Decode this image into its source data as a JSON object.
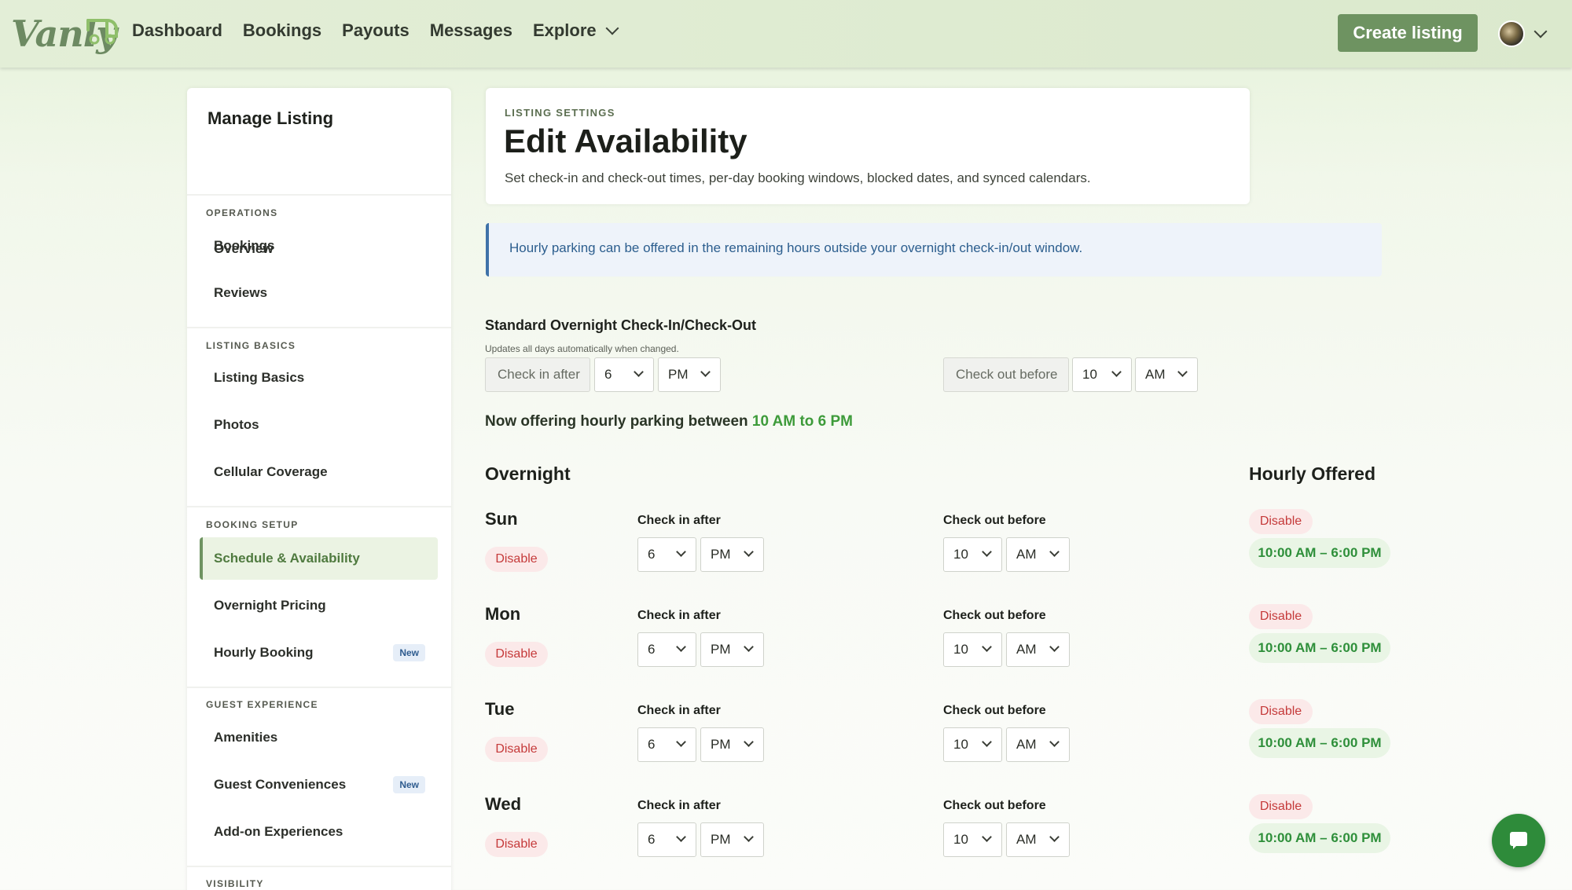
{
  "app": {
    "logo_text": "Vanly"
  },
  "nav": {
    "items": [
      "Dashboard",
      "Bookings",
      "Payouts",
      "Messages",
      "Explore"
    ],
    "create_label": "Create listing"
  },
  "sidebar": {
    "title": "Manage Listing",
    "overview": "Overview",
    "sections": [
      {
        "label": "OPERATIONS",
        "items": [
          "Bookings",
          "Reviews"
        ]
      },
      {
        "label": "LISTING BASICS",
        "items": [
          "Listing Basics",
          "Photos",
          "Cellular Coverage"
        ]
      },
      {
        "label": "BOOKING SETUP",
        "items": [
          "Schedule & Availability",
          "Overnight Pricing",
          "Hourly Booking"
        ]
      },
      {
        "label": "GUEST EXPERIENCE",
        "items": [
          "Amenities",
          "Guest Conveniences",
          "Add-on Experiences"
        ]
      },
      {
        "label": "VISIBILITY",
        "items": []
      }
    ],
    "active_item": "Schedule & Availability",
    "new_badge": "New"
  },
  "header": {
    "eyebrow": "LISTING SETTINGS",
    "title": "Edit Availability",
    "subtitle": "Set check-in and check-out times, per-day booking windows, blocked dates, and synced calendars."
  },
  "banner": {
    "text": "Hourly parking can be offered in the remaining hours outside your overnight check-in/out window."
  },
  "standard": {
    "title": "Standard Overnight Check-In/Check-Out",
    "note": "Updates all days automatically when changed.",
    "checkin_label": "Check in after",
    "checkin_hour": "6",
    "checkin_ampm": "PM",
    "checkout_label": "Check out before",
    "checkout_hour": "10",
    "checkout_ampm": "AM"
  },
  "offer": {
    "prefix": "Now offering hourly parking between",
    "window": "10 AM to 6 PM"
  },
  "columns": {
    "overnight": "Overnight",
    "hourly": "Hourly Offered"
  },
  "days": [
    {
      "name": "Sun",
      "disable": "Disable",
      "checkin_label": "Check in after",
      "checkin_hour": "6",
      "checkin_ampm": "PM",
      "checkout_label": "Check out before",
      "checkout_hour": "10",
      "checkout_ampm": "AM",
      "hourly_disable": "Disable",
      "hourly_window": "10:00 AM – 6:00 PM"
    },
    {
      "name": "Mon",
      "disable": "Disable",
      "checkin_label": "Check in after",
      "checkin_hour": "6",
      "checkin_ampm": "PM",
      "checkout_label": "Check out before",
      "checkout_hour": "10",
      "checkout_ampm": "AM",
      "hourly_disable": "Disable",
      "hourly_window": "10:00 AM – 6:00 PM"
    },
    {
      "name": "Tue",
      "disable": "Disable",
      "checkin_label": "Check in after",
      "checkin_hour": "6",
      "checkin_ampm": "PM",
      "checkout_label": "Check out before",
      "checkout_hour": "10",
      "checkout_ampm": "AM",
      "hourly_disable": "Disable",
      "hourly_window": "10:00 AM – 6:00 PM"
    },
    {
      "name": "Wed",
      "disable": "Disable",
      "checkin_label": "Check in after",
      "checkin_hour": "6",
      "checkin_ampm": "PM",
      "checkout_label": "Check out before",
      "checkout_hour": "10",
      "checkout_ampm": "AM",
      "hourly_disable": "Disable",
      "hourly_window": "10:00 AM – 6:00 PM"
    }
  ],
  "icons": {
    "chat": "chat-bubble-icon",
    "dropdown": "chevron-down-icon"
  },
  "colors": {
    "brand": "#6e9361",
    "accent_green": "#3d9b3a",
    "danger": "#c53a3a",
    "info": "#3f72a8"
  }
}
